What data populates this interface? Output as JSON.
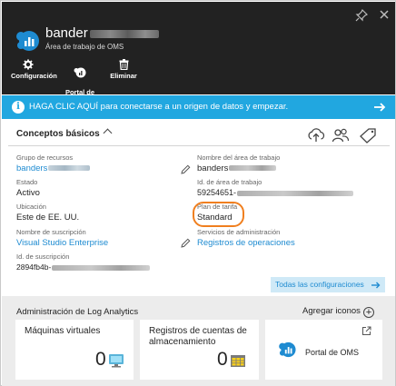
{
  "window": {
    "title": "bander",
    "subtitle": "Área de trabajo de OMS",
    "pin_icon": "pin-icon",
    "close_icon": "close-icon"
  },
  "commands": [
    {
      "label": "Configuración",
      "icon": "gear-icon"
    },
    {
      "label": "Portal de\nOMS",
      "icon": "oms-portal-icon"
    },
    {
      "label": "Eliminar",
      "icon": "trash-icon"
    }
  ],
  "banner": {
    "text": "HAGA CLIC AQUÍ para conectarse a un origen de datos y empezar.",
    "icon": "info-icon",
    "action_icon": "arrow-right-icon",
    "color": "#21a7e0"
  },
  "essentials": {
    "heading": "Conceptos básicos",
    "toolbar_icons": [
      "cloud-upload-icon",
      "users-icon",
      "tag-icon"
    ],
    "left": [
      {
        "label": "Grupo de recursos",
        "value": "banders",
        "link": true,
        "editable": true
      },
      {
        "label": "Estado",
        "value": "Activo"
      },
      {
        "label": "Ubicación",
        "value": "Este de EE. UU."
      },
      {
        "label": "Nombre de suscripción",
        "value": "Visual Studio Enterprise",
        "link": true,
        "editable": true
      },
      {
        "label": "Id. de suscripción",
        "value": "2894fb4b-"
      }
    ],
    "right": [
      {
        "label": "Nombre del área de trabajo",
        "value": "banders"
      },
      {
        "label": "Id. de área de trabajo",
        "value": "59254651-"
      },
      {
        "label": "Plan de tarifa",
        "value": "Standard",
        "highlighted": true
      },
      {
        "label": "Servicios de administración",
        "value": "Registros de operaciones",
        "link": true
      }
    ],
    "all_settings_label": "Todas las configuraciones",
    "highlight_color": "#f07f1f"
  },
  "log_analytics": {
    "title": "Administración de Log Analytics",
    "add_tiles_label": "Agregar iconos",
    "tiles": [
      {
        "title": "Máquinas virtuales",
        "count": "0",
        "icon": "virtual-machine-icon"
      },
      {
        "title": "Registros de cuentas de almacenamiento",
        "count": "0",
        "icon": "storage-account-icon"
      },
      {
        "title": "Portal de OMS",
        "icon": "oms-logo-icon",
        "external_icon": "external-link-icon"
      }
    ]
  }
}
